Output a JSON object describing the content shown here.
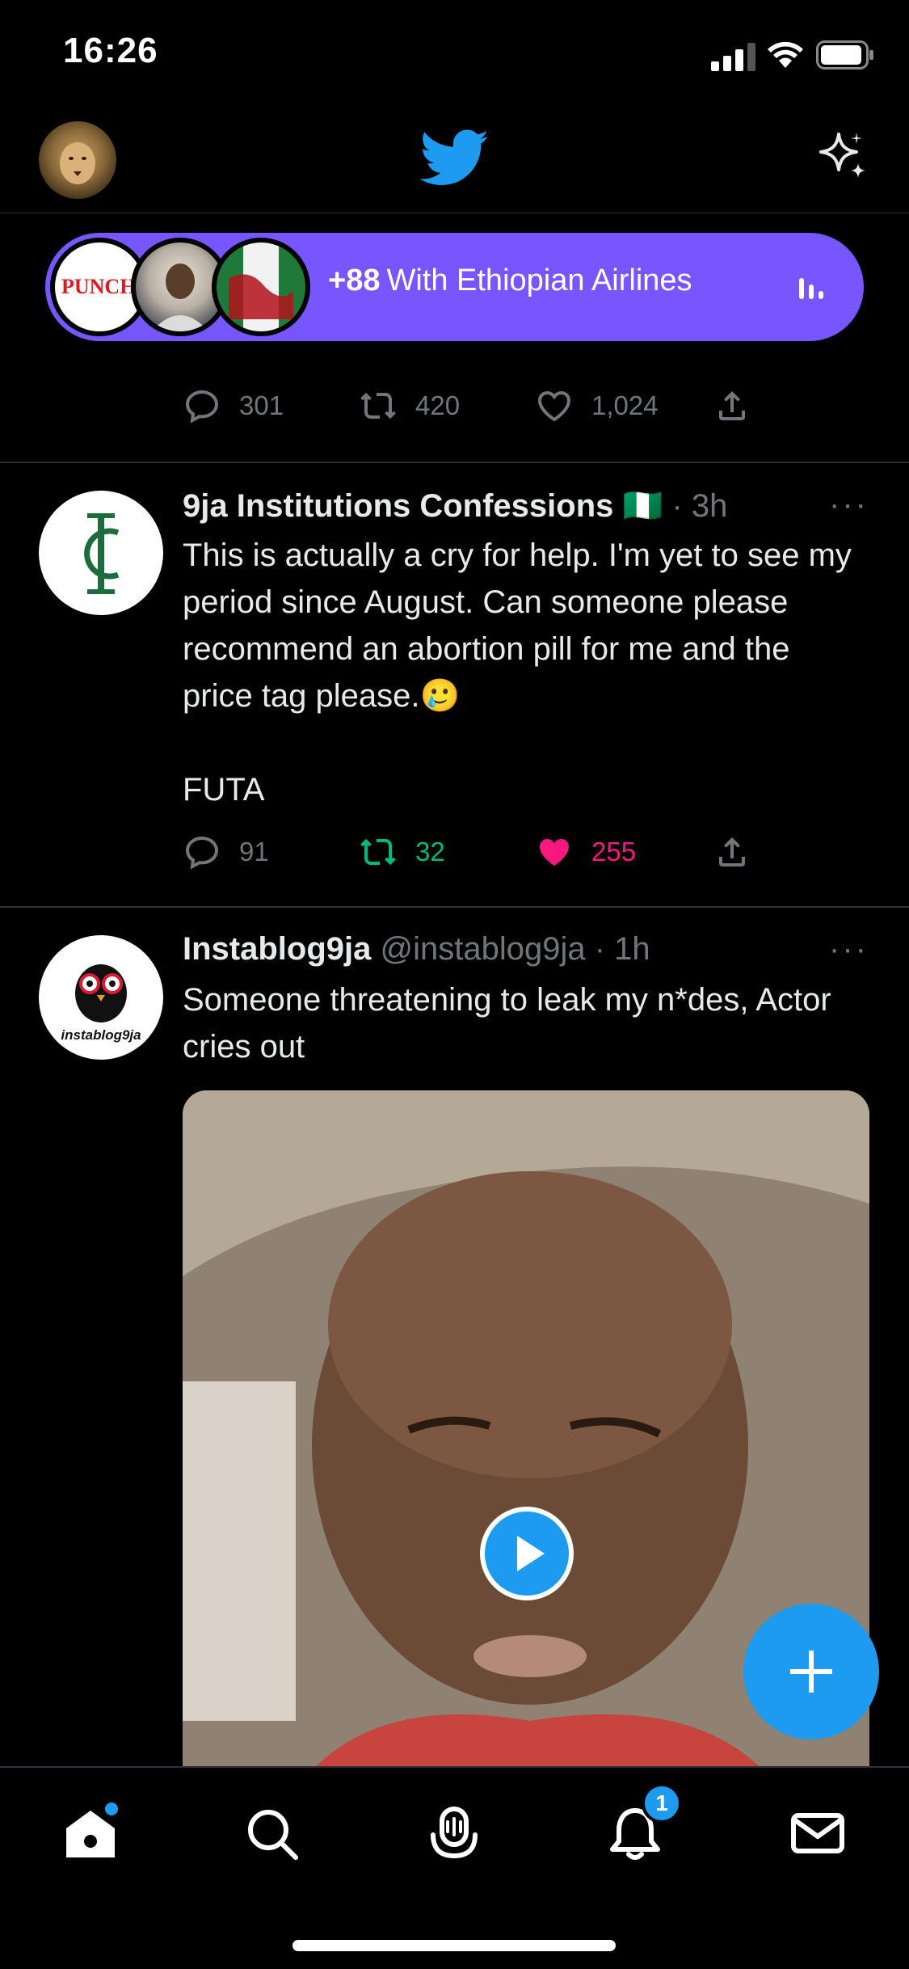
{
  "status_bar": {
    "time": "16:26"
  },
  "spaces": {
    "count": "+88",
    "title_fragment": "With Ethiopian Airlines",
    "title_fragment_hidden": "W",
    "first_avatar_label": "PUNCH"
  },
  "prev_tweet": {
    "replies": "301",
    "retweets": "420",
    "likes": "1,024"
  },
  "tweet1": {
    "name": "9ja Institutions Confessions",
    "flag": "🇳🇬",
    "time": "· 3h",
    "body": "This is actually a cry for help. I'm yet to see my period since August. Can someone please recommend an abortion pill for me and the price tag please.",
    "emoji": "🥲",
    "footer": "FUTA",
    "replies": "91",
    "retweets": "32",
    "likes": "255",
    "more": "···"
  },
  "tweet2": {
    "name": "Instablog9ja",
    "handle": "@instablog9ja",
    "time": "· 1h",
    "body": "Someone threatening to leak my n*des, Actor cries out",
    "avatar_label": "instablog9ja",
    "more": "···"
  },
  "tabbar": {
    "notification_badge": "1"
  },
  "colors": {
    "accent": "#1d9bf0",
    "spaces": "#7856ff",
    "like": "#f91880",
    "retweet": "#00ba7c"
  }
}
